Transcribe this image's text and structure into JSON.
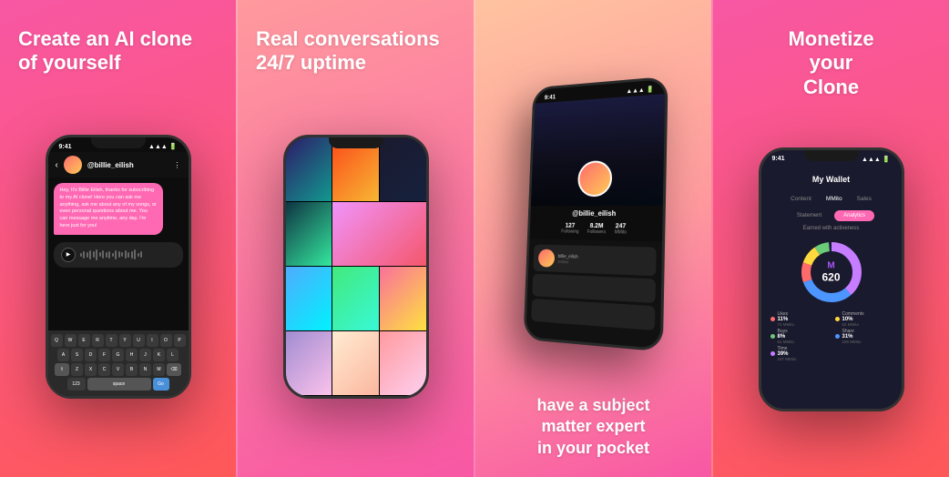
{
  "panels": [
    {
      "id": "panel-1",
      "headline_line1": "Create an AI clone",
      "headline_line2": "of yourself"
    },
    {
      "id": "panel-2",
      "headline_line1": "Real conversations",
      "headline_line2": "24/7 uptime"
    },
    {
      "id": "panel-3",
      "subtext_line1": "have a subject",
      "subtext_line2": "matter expert",
      "subtext_line3": "in your pocket"
    },
    {
      "id": "panel-4",
      "headline_line1": "Monetize",
      "headline_line2": "your",
      "headline_line3": "Clone"
    }
  ],
  "phone1": {
    "time": "9:41",
    "username": "@billie_eilish",
    "chat_message": "Hey, It's Billie Eilish, thanks for subscribing to my AI clone! Here you can ask me anything, ask me about any of my songs, or even personal questions about me. You can message me anytime, any day. I'm here just for you!",
    "keyboard_rows": [
      [
        "Q",
        "W",
        "E",
        "R",
        "T",
        "Y",
        "U",
        "I",
        "O",
        "P"
      ],
      [
        "A",
        "S",
        "D",
        "F",
        "G",
        "H",
        "J",
        "K",
        "L"
      ],
      [
        "Z",
        "X",
        "C",
        "V",
        "B",
        "N",
        "M"
      ]
    ]
  },
  "phone3": {
    "username": "@billie_eilish",
    "stats": [
      {
        "num": "127",
        "label": "Following"
      },
      {
        "num": "8.2M",
        "label": "Followers"
      },
      {
        "num": "247",
        "label": "MMito"
      }
    ]
  },
  "wallet": {
    "title": "My Wallet",
    "tabs": [
      "Content",
      "MMito",
      "Sales"
    ],
    "active_tab": "MMito",
    "subtabs": [
      "Statement",
      "Analytics"
    ],
    "active_subtab": "Analytics",
    "earned_label": "Earned with activeness",
    "total": "620",
    "legend": [
      {
        "name": "Likes",
        "pct": "11%",
        "amount": "74 MMito",
        "color": "#ff6b6b"
      },
      {
        "name": "Comments",
        "pct": "10%",
        "amount": "62 MMito",
        "color": "#ffd93d"
      },
      {
        "name": "Buys",
        "pct": "8%",
        "amount": "51 MMito",
        "color": "#6bcb77"
      },
      {
        "name": "Share",
        "pct": "31%",
        "amount": "186 MMito",
        "color": "#4d96ff"
      },
      {
        "name": "Time",
        "pct": "39%",
        "amount": "247 MMito",
        "color": "#c77dff"
      }
    ]
  }
}
